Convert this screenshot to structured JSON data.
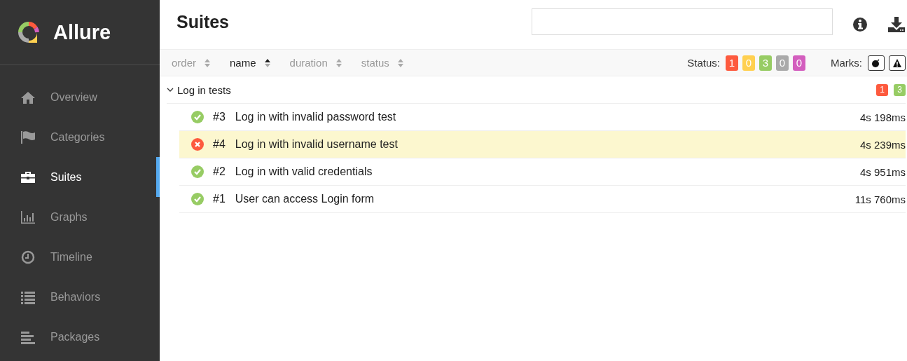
{
  "brand": {
    "name": "Allure"
  },
  "sidebar": {
    "items": [
      {
        "label": "Overview",
        "selected": false
      },
      {
        "label": "Categories",
        "selected": false
      },
      {
        "label": "Suites",
        "selected": true
      },
      {
        "label": "Graphs",
        "selected": false
      },
      {
        "label": "Timeline",
        "selected": false
      },
      {
        "label": "Behaviors",
        "selected": false
      },
      {
        "label": "Packages",
        "selected": false
      }
    ]
  },
  "header": {
    "title": "Suites"
  },
  "sort": [
    {
      "label": "order",
      "selected": false
    },
    {
      "label": "name",
      "selected": true
    },
    {
      "label": "duration",
      "selected": false
    },
    {
      "label": "status",
      "selected": false
    }
  ],
  "status_filter": {
    "label": "Status:",
    "counts": [
      {
        "value": "1",
        "color": "#fd5a3e"
      },
      {
        "value": "0",
        "color": "#ffd050"
      },
      {
        "value": "3",
        "color": "#97cc64"
      },
      {
        "value": "0",
        "color": "#aaaaaa"
      },
      {
        "value": "0",
        "color": "#d35ebe"
      }
    ]
  },
  "marks": {
    "label": "Marks:",
    "items": [
      {
        "kind": "flaky"
      },
      {
        "kind": "warning"
      }
    ]
  },
  "groups": [
    {
      "name": "Log in tests",
      "expanded": true,
      "counts": [
        {
          "value": "1",
          "color": "#fd5a3e"
        },
        {
          "value": "3",
          "color": "#97cc64"
        }
      ],
      "tests": [
        {
          "order": "#3",
          "name": "Log in with invalid password test",
          "duration": "4s 198ms",
          "kind": "passed",
          "selected": false
        },
        {
          "order": "#4",
          "name": "Log in with invalid username test",
          "duration": "4s 239ms",
          "kind": "failed",
          "selected": true
        },
        {
          "order": "#2",
          "name": "Log in with valid credentials",
          "duration": "4s 951ms",
          "kind": "passed",
          "selected": false
        },
        {
          "order": "#1",
          "name": "User can access Login form",
          "duration": "11s 760ms",
          "kind": "passed",
          "selected": false
        }
      ]
    }
  ]
}
